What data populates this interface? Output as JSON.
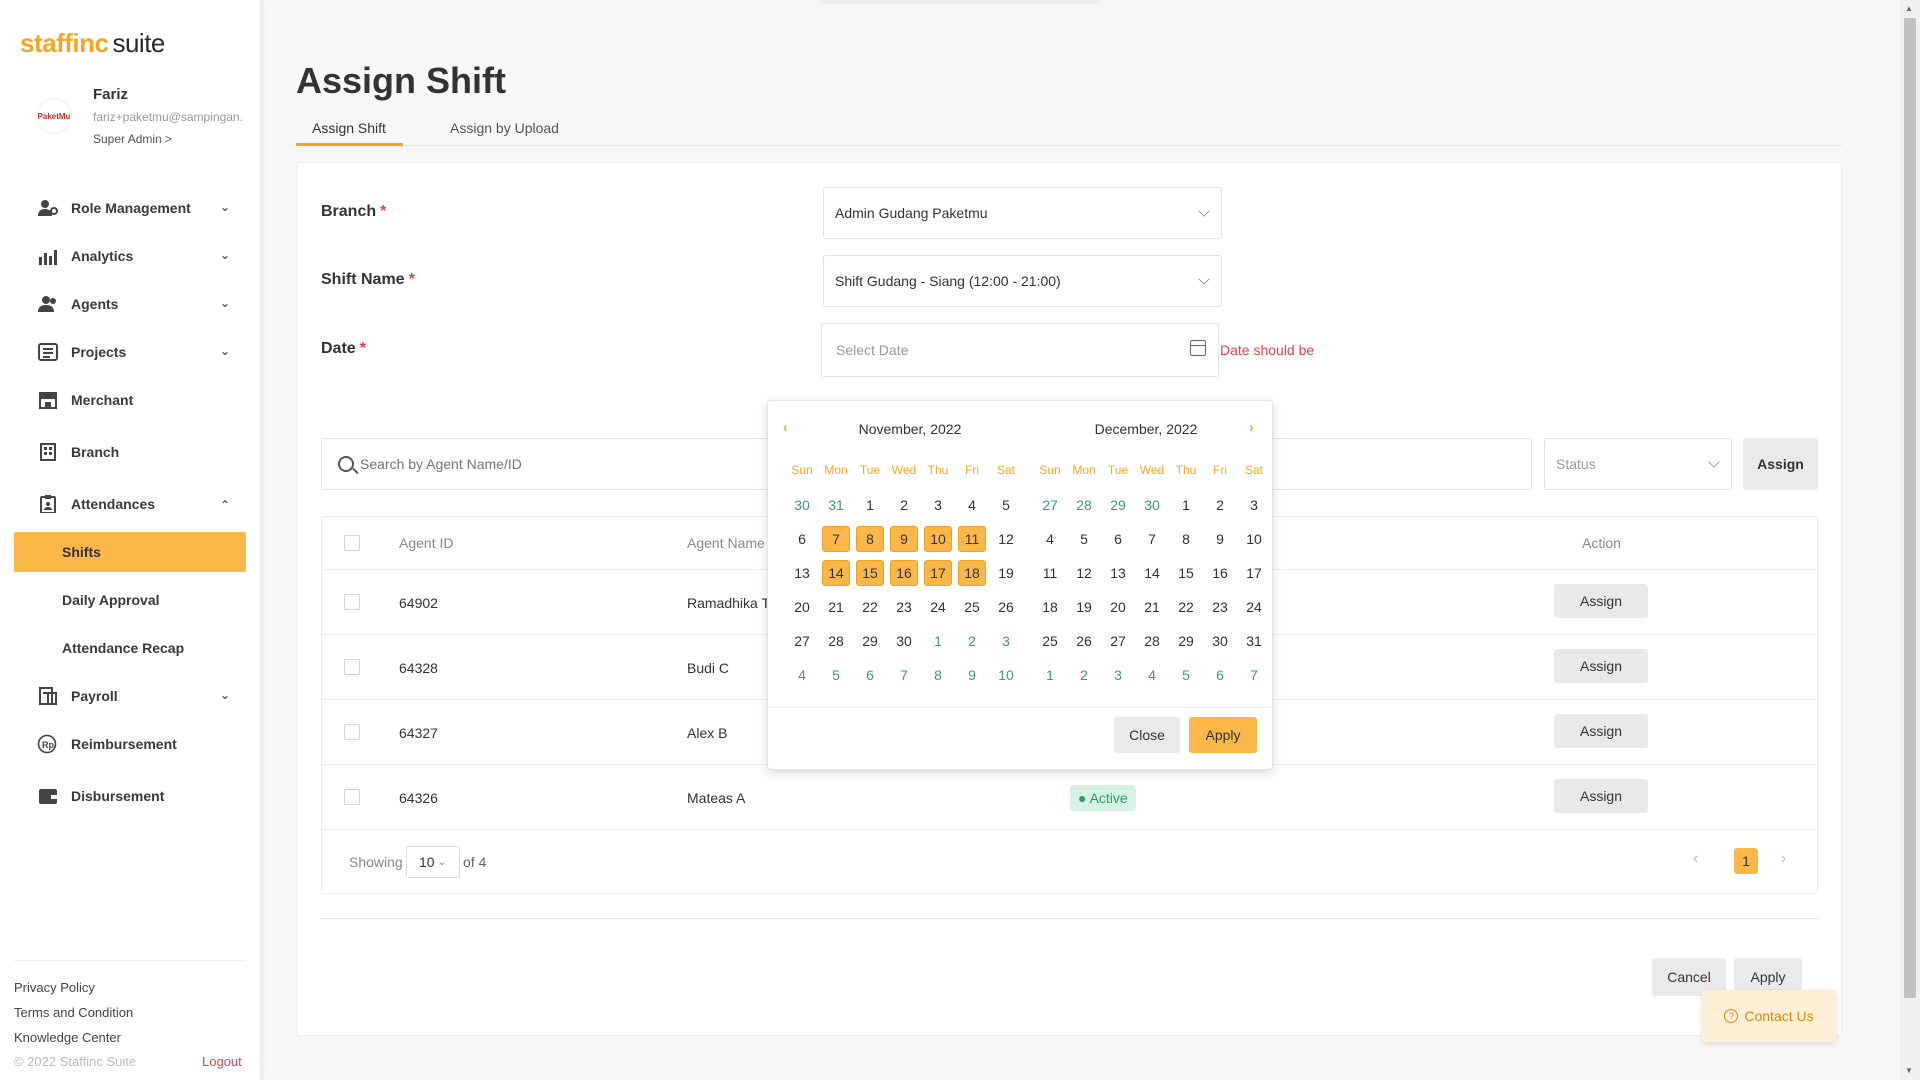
{
  "app": {
    "logo_part1": "staffinc",
    "logo_part2": "suite"
  },
  "profile": {
    "name": "Fariz",
    "email": "fariz+paketmu@sampingan.",
    "role": "Super Admin >",
    "avatar_text": "PaketMu"
  },
  "sidebar": {
    "items": [
      {
        "label": "Role Management"
      },
      {
        "label": "Analytics"
      },
      {
        "label": "Agents"
      },
      {
        "label": "Projects"
      },
      {
        "label": "Merchant"
      },
      {
        "label": "Branch"
      },
      {
        "label": "Attendances"
      },
      {
        "label": "Payroll"
      },
      {
        "label": "Reimbursement"
      },
      {
        "label": "Disbursement"
      }
    ],
    "subitems": [
      {
        "label": "Shifts"
      },
      {
        "label": "Daily Approval"
      },
      {
        "label": "Attendance Recap"
      }
    ],
    "footer": {
      "privacy": "Privacy Policy",
      "terms": "Terms and Condition",
      "knowledge": "Knowledge Center",
      "copyright": "© 2022 Staffinc Suite",
      "logout": "Logout"
    }
  },
  "page": {
    "title": "Assign Shift"
  },
  "tabs": [
    {
      "label": "Assign Shift"
    },
    {
      "label": "Assign by Upload"
    }
  ],
  "form": {
    "branch_label": "Branch",
    "branch_value": "Admin Gudang Paketmu",
    "shift_label": "Shift Name",
    "shift_value": "Shift Gudang - Siang (12:00 - 21:00)",
    "date_label": "Date",
    "date_placeholder": "Select Date",
    "date_error": "Date should be",
    "required_mark": "*"
  },
  "filters": {
    "search_placeholder": "Search by Agent Name/ID",
    "status_placeholder": "Status",
    "assign_label": "Assign"
  },
  "table": {
    "headers": {
      "agent_id": "Agent ID",
      "agent_name": "Agent Name",
      "action": "Action"
    },
    "rows": [
      {
        "id": "64902",
        "name": "Ramadhika T",
        "status": "",
        "action": "Assign"
      },
      {
        "id": "64328",
        "name": "Budi C",
        "status": "",
        "action": "Assign"
      },
      {
        "id": "64327",
        "name": "Alex B",
        "status": "",
        "action": "Assign"
      },
      {
        "id": "64326",
        "name": "Mateas A",
        "status": "● Active",
        "action": "Assign"
      }
    ],
    "footer": {
      "showing": "Showing",
      "page_size": "10",
      "of_total": "of 4",
      "current_page": "1",
      "prev": "‹",
      "next": "›"
    }
  },
  "actions": {
    "cancel": "Cancel",
    "apply": "Apply",
    "contact": "Contact Us"
  },
  "datepicker": {
    "prev": "‹",
    "next": "›",
    "months": [
      {
        "title": "November, 2022",
        "weekdays": [
          "Sun",
          "Mon",
          "Tue",
          "Wed",
          "Thu",
          "Fri",
          "Sat"
        ],
        "weeks": [
          [
            {
              "d": "30",
              "m": 1
            },
            {
              "d": "31",
              "m": 1
            },
            {
              "d": "1"
            },
            {
              "d": "2"
            },
            {
              "d": "3"
            },
            {
              "d": "4"
            },
            {
              "d": "5"
            }
          ],
          [
            {
              "d": "6"
            },
            {
              "d": "7",
              "s": 1
            },
            {
              "d": "8",
              "s": 1
            },
            {
              "d": "9",
              "s": 1
            },
            {
              "d": "10",
              "s": 1
            },
            {
              "d": "11",
              "s": 1
            },
            {
              "d": "12"
            }
          ],
          [
            {
              "d": "13"
            },
            {
              "d": "14",
              "s": 1
            },
            {
              "d": "15",
              "s": 1
            },
            {
              "d": "16",
              "s": 1
            },
            {
              "d": "17",
              "s": 1
            },
            {
              "d": "18",
              "s": 1
            },
            {
              "d": "19"
            }
          ],
          [
            {
              "d": "20"
            },
            {
              "d": "21"
            },
            {
              "d": "22"
            },
            {
              "d": "23"
            },
            {
              "d": "24"
            },
            {
              "d": "25"
            },
            {
              "d": "26"
            }
          ],
          [
            {
              "d": "27"
            },
            {
              "d": "28"
            },
            {
              "d": "29"
            },
            {
              "d": "30"
            },
            {
              "d": "1",
              "m": 1
            },
            {
              "d": "2",
              "m": 1
            },
            {
              "d": "3",
              "m": 1
            }
          ],
          [
            {
              "d": "4",
              "m": 1
            },
            {
              "d": "5",
              "m": 1
            },
            {
              "d": "6",
              "m": 1
            },
            {
              "d": "7",
              "m": 1
            },
            {
              "d": "8",
              "m": 1
            },
            {
              "d": "9",
              "m": 1
            },
            {
              "d": "10",
              "m": 1
            }
          ]
        ]
      },
      {
        "title": "December, 2022",
        "weekdays": [
          "Sun",
          "Mon",
          "Tue",
          "Wed",
          "Thu",
          "Fri",
          "Sat"
        ],
        "weeks": [
          [
            {
              "d": "27",
              "m": 1
            },
            {
              "d": "28",
              "m": 1
            },
            {
              "d": "29",
              "m": 1
            },
            {
              "d": "30",
              "m": 1
            },
            {
              "d": "1"
            },
            {
              "d": "2"
            },
            {
              "d": "3"
            }
          ],
          [
            {
              "d": "4"
            },
            {
              "d": "5"
            },
            {
              "d": "6"
            },
            {
              "d": "7"
            },
            {
              "d": "8"
            },
            {
              "d": "9"
            },
            {
              "d": "10"
            }
          ],
          [
            {
              "d": "11"
            },
            {
              "d": "12"
            },
            {
              "d": "13"
            },
            {
              "d": "14"
            },
            {
              "d": "15"
            },
            {
              "d": "16"
            },
            {
              "d": "17"
            }
          ],
          [
            {
              "d": "18"
            },
            {
              "d": "19"
            },
            {
              "d": "20"
            },
            {
              "d": "21"
            },
            {
              "d": "22"
            },
            {
              "d": "23"
            },
            {
              "d": "24"
            }
          ],
          [
            {
              "d": "25"
            },
            {
              "d": "26"
            },
            {
              "d": "27"
            },
            {
              "d": "28"
            },
            {
              "d": "29"
            },
            {
              "d": "30"
            },
            {
              "d": "31"
            }
          ],
          [
            {
              "d": "1",
              "m": 1
            },
            {
              "d": "2",
              "m": 1
            },
            {
              "d": "3",
              "m": 1
            },
            {
              "d": "4",
              "m": 1
            },
            {
              "d": "5",
              "m": 1
            },
            {
              "d": "6",
              "m": 1
            },
            {
              "d": "7",
              "m": 1
            }
          ]
        ]
      }
    ],
    "close_label": "Close",
    "apply_label": "Apply"
  },
  "colors": {
    "accent": "#fbb848",
    "brand_orange": "#f5a623",
    "error": "#e0434f",
    "active_green": "#2e9e60"
  },
  "icons": [
    "user-gear-icon",
    "bar-chart-icon",
    "users-icon",
    "list-icon",
    "store-icon",
    "building-icon",
    "clipboard-icon",
    "receipt-icon",
    "rupiah-icon",
    "wallet-icon",
    "search-icon",
    "calendar-icon",
    "chevron-down-icon",
    "question-icon"
  ]
}
